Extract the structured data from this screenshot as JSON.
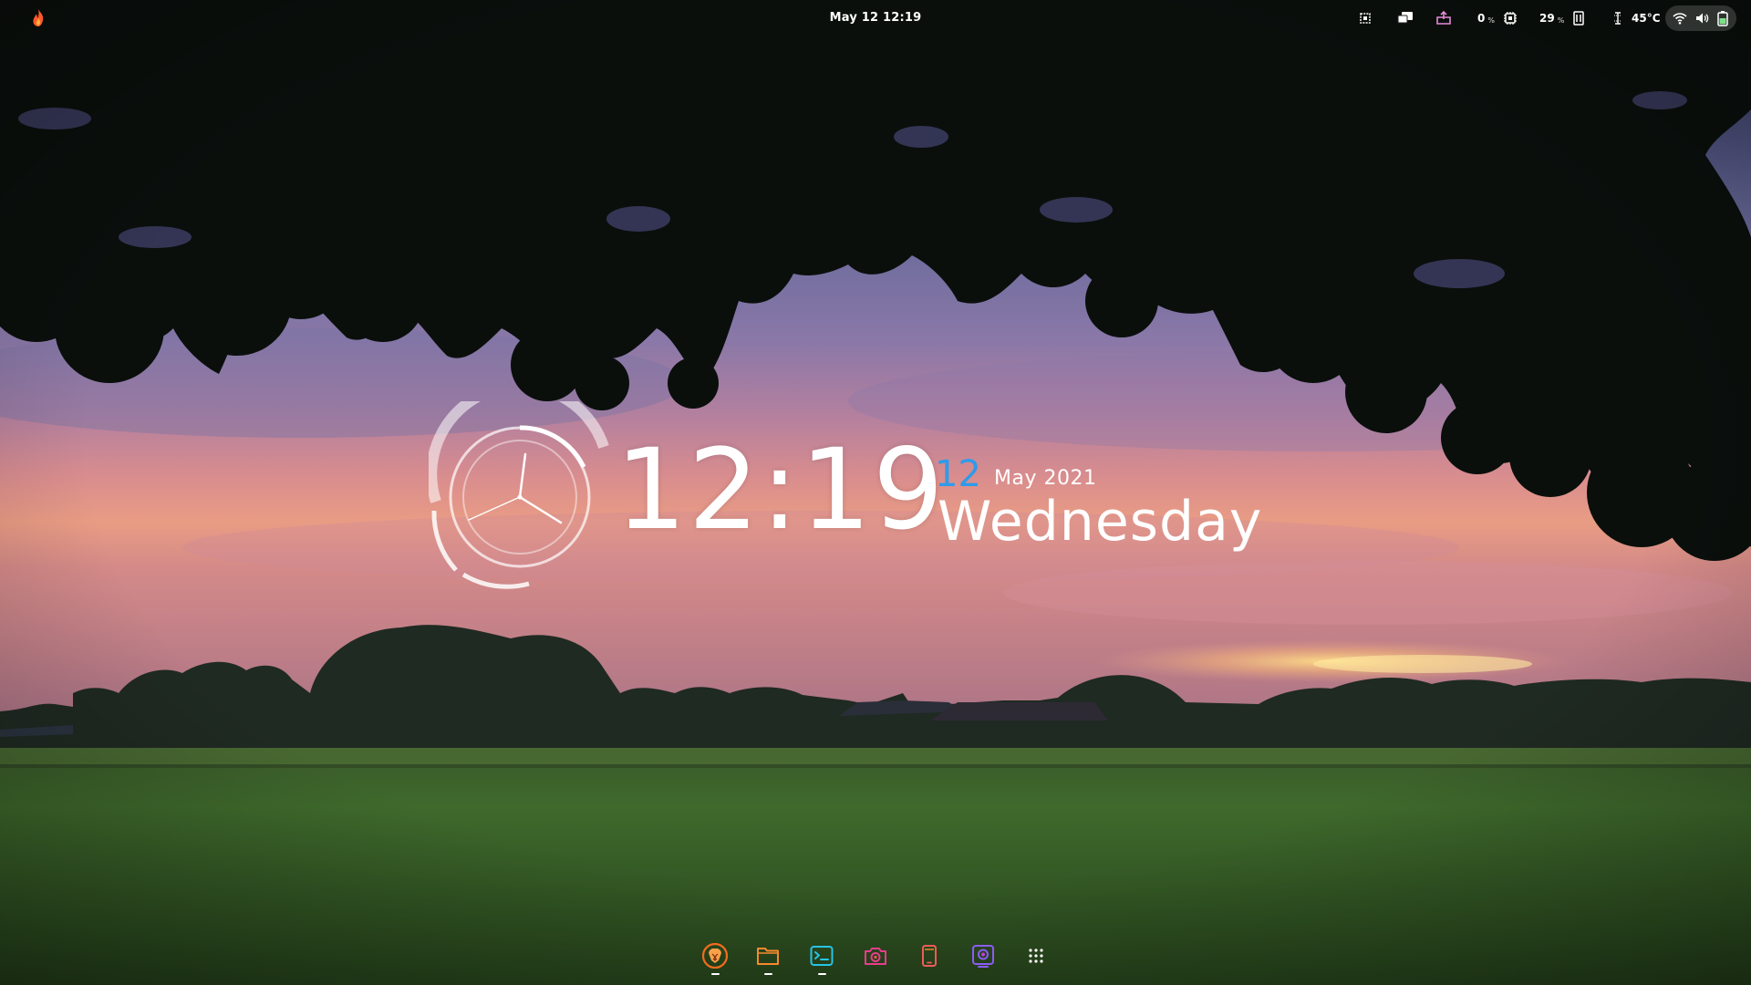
{
  "topbar": {
    "activities_icon": "flame-icon",
    "clock_label": "May 12  12:19",
    "tray": [
      {
        "name": "screenshot-icon",
        "value": "",
        "unit": ""
      },
      {
        "name": "display-icon",
        "value": "",
        "unit": ""
      },
      {
        "name": "package-updates-icon",
        "value": "",
        "unit": ""
      },
      {
        "name": "cpu-icon",
        "value": "0",
        "unit": "%"
      },
      {
        "name": "memory-icon",
        "value": "29",
        "unit": "%"
      },
      {
        "name": "temperature-icon",
        "value": "45°C",
        "unit": ""
      }
    ],
    "system_menu": [
      "wifi-icon",
      "volume-icon",
      "battery-icon"
    ]
  },
  "clock_widget": {
    "time": "12:19",
    "day": "12",
    "month_year": "May 2021",
    "weekday": "Wednesday"
  },
  "dock": {
    "items": [
      {
        "name": "brave-browser-icon",
        "running": true,
        "color": "#f26b1d"
      },
      {
        "name": "files-icon",
        "running": true,
        "color": "#f58a2b"
      },
      {
        "name": "terminal-icon",
        "running": true,
        "color": "#27c3e6"
      },
      {
        "name": "camera-icon",
        "running": false,
        "color": "#e83d8b"
      },
      {
        "name": "tablet-icon",
        "running": false,
        "color": "#f25a5a"
      },
      {
        "name": "screen-recorder-icon",
        "running": false,
        "color": "#8b5cf6"
      },
      {
        "name": "app-grid-icon",
        "running": false,
        "color": "#ffffff"
      }
    ]
  },
  "colors": {
    "accent_blue": "#2e9bea",
    "text": "#ffffff"
  }
}
